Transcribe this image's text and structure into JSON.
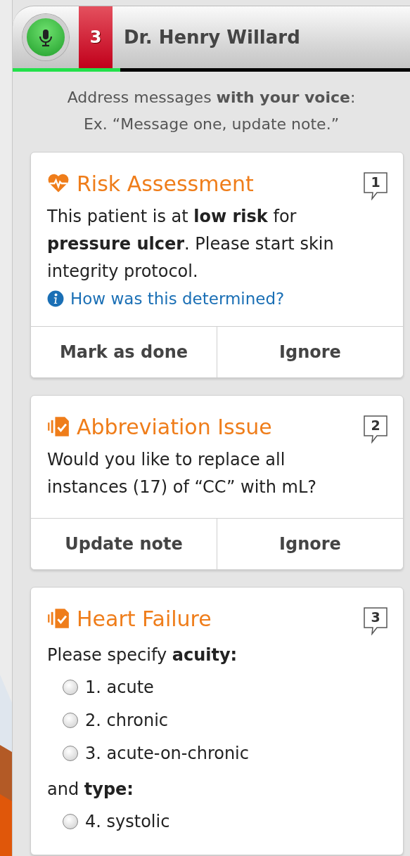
{
  "header": {
    "voice_active": true,
    "unread_count": "3",
    "doctor_name": "Dr. Henry Willard",
    "progress": {
      "level": 0.27
    }
  },
  "instructions": [
    "Address messages **with your voice**:",
    "Ex. “Message one, update note.”"
  ],
  "messages": [
    {
      "kind": "risk",
      "title": "Risk Assessment",
      "number": "1",
      "body": "This patient is at **low risk** for **pressure ulcer**. Please start skin integrity protocol.",
      "link": "How was this determined?",
      "actions": [
        "Mark as done",
        "Ignore"
      ]
    },
    {
      "kind": "document",
      "title": "Abbreviation Issue",
      "number": "2",
      "body": "Would you like to replace all instances (17) of “CC” with mL?",
      "actions": [
        "Update note",
        "Ignore"
      ]
    },
    {
      "kind": "document",
      "title": "Heart Failure",
      "number": "3",
      "sections": [
        {
          "prompt": "Please specify **acuity:**",
          "options": [
            {
              "label": "1. acute",
              "selected": false
            },
            {
              "label": "2. chronic",
              "selected": false
            },
            {
              "label": "3. acute-on-chronic",
              "selected": false
            }
          ]
        },
        {
          "prompt": "and **type:**",
          "options": [
            {
              "label": "4. systolic",
              "selected": false
            }
          ]
        }
      ]
    }
  ]
}
